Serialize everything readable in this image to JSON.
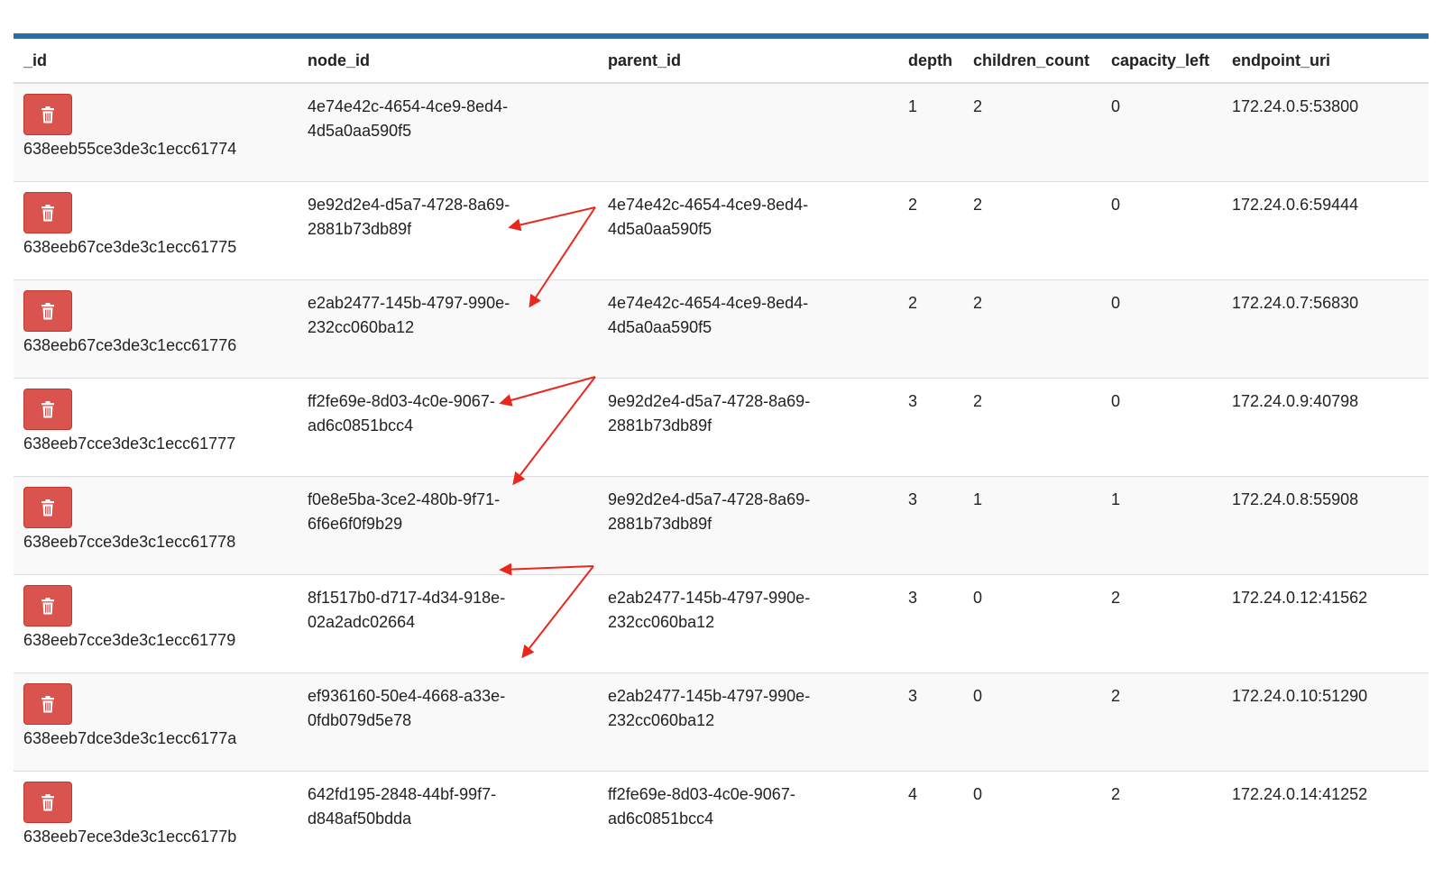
{
  "colors": {
    "accent_bar": "#2e6da4",
    "delete_button": "#d9534f",
    "arrow": "#e8281c"
  },
  "icons": {
    "delete": "trash-icon"
  },
  "columns": [
    "_id",
    "node_id",
    "parent_id",
    "depth",
    "children_count",
    "capacity_left",
    "endpoint_uri"
  ],
  "rows": [
    {
      "id": "638eeb55ce3de3c1ecc61774",
      "node_id_1": "4e74e42c-4654-4ce9-8ed4-",
      "node_id_2": "4d5a0aa590f5",
      "parent_id_1": "",
      "parent_id_2": "",
      "depth": "1",
      "children_count": "2",
      "capacity_left": "0",
      "endpoint_uri": "172.24.0.5:53800"
    },
    {
      "id": "638eeb67ce3de3c1ecc61775",
      "node_id_1": "9e92d2e4-d5a7-4728-8a69-",
      "node_id_2": "2881b73db89f",
      "parent_id_1": "4e74e42c-4654-4ce9-8ed4-",
      "parent_id_2": "4d5a0aa590f5",
      "depth": "2",
      "children_count": "2",
      "capacity_left": "0",
      "endpoint_uri": "172.24.0.6:59444"
    },
    {
      "id": "638eeb67ce3de3c1ecc61776",
      "node_id_1": "e2ab2477-145b-4797-990e-",
      "node_id_2": "232cc060ba12",
      "parent_id_1": "4e74e42c-4654-4ce9-8ed4-",
      "parent_id_2": "4d5a0aa590f5",
      "depth": "2",
      "children_count": "2",
      "capacity_left": "0",
      "endpoint_uri": "172.24.0.7:56830"
    },
    {
      "id": "638eeb7cce3de3c1ecc61777",
      "node_id_1": "ff2fe69e-8d03-4c0e-9067-",
      "node_id_2": "ad6c0851bcc4",
      "parent_id_1": "9e92d2e4-d5a7-4728-8a69-",
      "parent_id_2": "2881b73db89f",
      "depth": "3",
      "children_count": "2",
      "capacity_left": "0",
      "endpoint_uri": "172.24.0.9:40798"
    },
    {
      "id": "638eeb7cce3de3c1ecc61778",
      "node_id_1": "f0e8e5ba-3ce2-480b-9f71-",
      "node_id_2": "6f6e6f0f9b29",
      "parent_id_1": "9e92d2e4-d5a7-4728-8a69-",
      "parent_id_2": "2881b73db89f",
      "depth": "3",
      "children_count": "1",
      "capacity_left": "1",
      "endpoint_uri": "172.24.0.8:55908"
    },
    {
      "id": "638eeb7cce3de3c1ecc61779",
      "node_id_1": "8f1517b0-d717-4d34-918e-",
      "node_id_2": "02a2adc02664",
      "parent_id_1": "e2ab2477-145b-4797-990e-",
      "parent_id_2": "232cc060ba12",
      "depth": "3",
      "children_count": "0",
      "capacity_left": "2",
      "endpoint_uri": "172.24.0.12:41562"
    },
    {
      "id": "638eeb7dce3de3c1ecc6177a",
      "node_id_1": "ef936160-50e4-4668-a33e-",
      "node_id_2": "0fdb079d5e78",
      "parent_id_1": "e2ab2477-145b-4797-990e-",
      "parent_id_2": "232cc060ba12",
      "depth": "3",
      "children_count": "0",
      "capacity_left": "2",
      "endpoint_uri": "172.24.0.10:51290"
    },
    {
      "id": "638eeb7ece3de3c1ecc6177b",
      "node_id_1": "642fd195-2848-44bf-99f7-",
      "node_id_2": "d848af50bdda",
      "parent_id_1": "ff2fe69e-8d03-4c0e-9067-",
      "parent_id_2": "ad6c0851bcc4",
      "depth": "4",
      "children_count": "0",
      "capacity_left": "2",
      "endpoint_uri": "172.24.0.14:41252"
    }
  ]
}
